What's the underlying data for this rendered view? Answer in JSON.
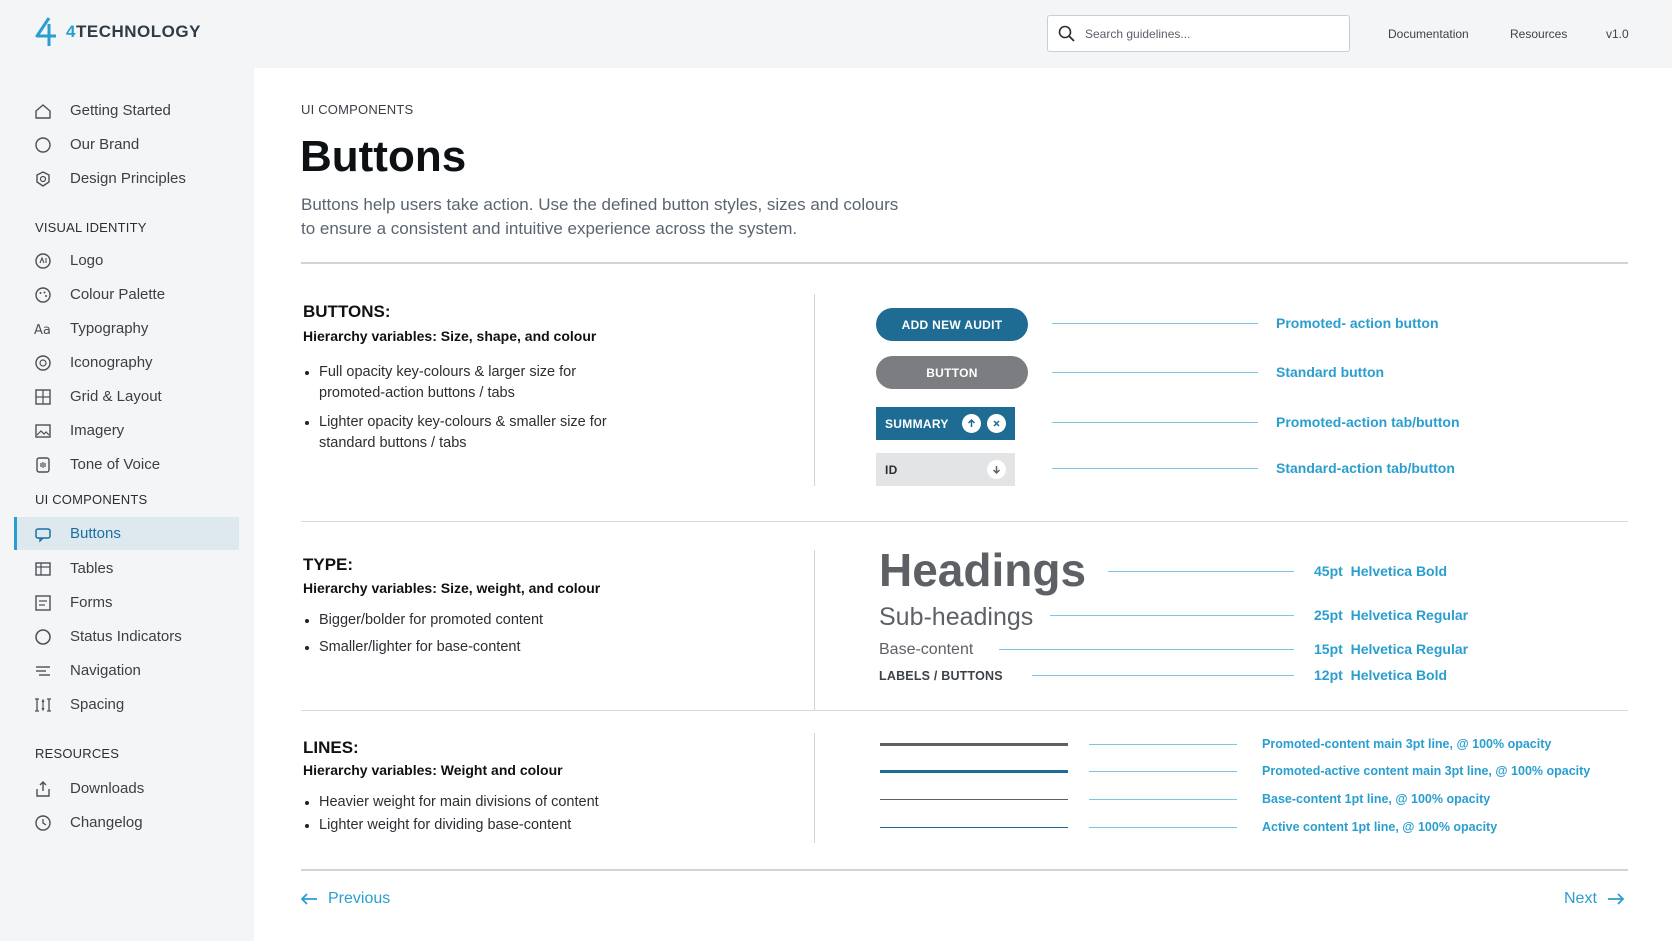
{
  "brand": {
    "name_prefix": "4",
    "name_rest": "TECHNOLOGY"
  },
  "header": {
    "search_placeholder": "Search guidelines...",
    "links": [
      "Documentation",
      "Resources",
      "v1.0"
    ]
  },
  "sidebar": {
    "top_items": [
      {
        "label": "Getting Started",
        "icon": "home-icon"
      },
      {
        "label": "Our Brand",
        "icon": "circle-icon"
      },
      {
        "label": "Design Principles",
        "icon": "badge-icon"
      }
    ],
    "sections": [
      {
        "title": "VISUAL IDENTITY",
        "items": [
          {
            "label": "Logo",
            "icon": "logo-icon"
          },
          {
            "label": "Colour Palette",
            "icon": "palette-icon"
          },
          {
            "label": "Typography",
            "icon": "typography-icon"
          },
          {
            "label": "Iconography",
            "icon": "iconography-icon"
          },
          {
            "label": "Grid & Layout",
            "icon": "grid-icon"
          },
          {
            "label": "Imagery",
            "icon": "image-icon"
          },
          {
            "label": "Tone of Voice",
            "icon": "voice-icon"
          }
        ]
      },
      {
        "title": "UI COMPONENTS",
        "items": [
          {
            "label": "Buttons",
            "icon": "button-icon",
            "active": true
          },
          {
            "label": "Tables",
            "icon": "table-icon"
          },
          {
            "label": "Forms",
            "icon": "form-icon"
          },
          {
            "label": "Status Indicators",
            "icon": "status-icon"
          },
          {
            "label": "Navigation",
            "icon": "navigation-icon"
          },
          {
            "label": "Spacing",
            "icon": "spacing-icon"
          }
        ]
      },
      {
        "title": "RESOURCES",
        "items": [
          {
            "label": "Downloads",
            "icon": "download-icon"
          },
          {
            "label": "Changelog",
            "icon": "changelog-icon"
          }
        ]
      }
    ]
  },
  "page": {
    "breadcrumb": "UI COMPONENTS",
    "title": "Buttons",
    "description": "Buttons help users take action. Use the defined button styles, sizes and colours to ensure a consistent and intuitive experience across the system."
  },
  "buttons_section": {
    "title": "BUTTONS:",
    "subtitle": "Hierarchy variables: Size, shape, and colour",
    "bullets": [
      "Full opacity key-colours & larger size for promoted-action buttons / tabs",
      "Lighter opacity key-colours & smaller size for standard buttons / tabs"
    ],
    "samples": {
      "promoted_label": "ADD NEW AUDIT",
      "standard_label": "BUTTON",
      "promoted_tab_label": "SUMMARY",
      "standard_tab_label": "ID"
    },
    "annotations": [
      "Promoted- action button",
      "Standard button",
      "Promoted-action tab/button",
      "Standard-action tab/button"
    ]
  },
  "type_section": {
    "title": "TYPE:",
    "subtitle": "Hierarchy variables: Size, weight, and colour",
    "bullets": [
      "Bigger/bolder for promoted content",
      "Smaller/lighter for base-content"
    ],
    "samples": {
      "heading": "Headings",
      "subheading": "Sub-headings",
      "base": "Base-content",
      "label": "LABELS / BUTTONS"
    },
    "annotations": [
      {
        "size": "45pt",
        "font": "Helvetica Bold"
      },
      {
        "size": "25pt",
        "font": "Helvetica Regular"
      },
      {
        "size": "15pt",
        "font": "Helvetica Regular"
      },
      {
        "size": "12pt",
        "font": "Helvetica Bold"
      }
    ]
  },
  "lines_section": {
    "title": "LINES:",
    "subtitle": "Hierarchy variables: Weight and colour",
    "bullets": [
      "Heavier weight for main divisions of content",
      "Lighter weight for dividing base-content"
    ],
    "annotations": [
      "Promoted-content main 3pt line, @ 100% opacity",
      "Promoted-active content main 3pt line, @ 100% opacity",
      "Base-content 1pt line, @ 100% opacity",
      "Active content 1pt line, @ 100% opacity"
    ]
  },
  "pager": {
    "previous": "Previous",
    "next": "Next"
  },
  "colors": {
    "accent": "#2a9ecf",
    "promoted_button": "#1e6c93",
    "standard_button": "#7b7d80",
    "standard_tab": "#e3e4e5",
    "promoted_line": "#5d6166",
    "active_line": "#1e6c93"
  }
}
